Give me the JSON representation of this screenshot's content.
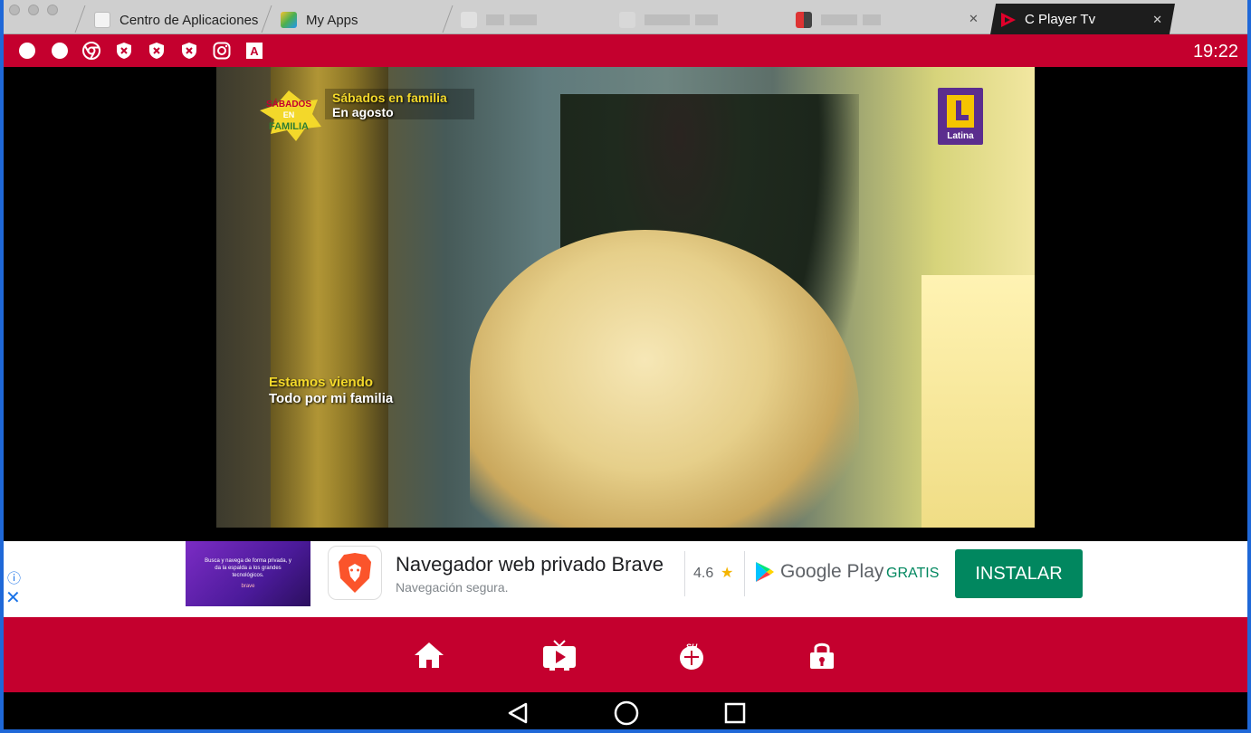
{
  "tabs": [
    {
      "label": "Centro de Aplicaciones",
      "icon": "app-center-icon"
    },
    {
      "label": "My Apps",
      "icon": "bluestacks-icon"
    },
    {
      "label": "",
      "icon": "blurred-tab-icon"
    },
    {
      "label": "",
      "icon": "blurred-tab-icon"
    },
    {
      "label": "",
      "icon": "blurred-tab-icon"
    },
    {
      "label": "C Player Tv",
      "icon": "c-player-icon",
      "active": true
    }
  ],
  "status_bar": {
    "time": "19:22",
    "icons": [
      "dot-icon",
      "dot-icon",
      "chrome-icon",
      "shield-x-icon",
      "shield-x-icon",
      "shield-x-icon",
      "instagram-icon",
      "a-icon"
    ]
  },
  "video": {
    "overlay_top_line1": "Sábados en familia",
    "overlay_top_line2": "En agosto",
    "logo_text_line1": "SÁBADOS",
    "logo_text_line2": "EN",
    "logo_text_line3": "FAMILIA",
    "overlay_bottom_line1": "Estamos viendo",
    "overlay_bottom_line2": "Todo por mi familia",
    "channel_name": "Latina"
  },
  "ad": {
    "thumb_text": "Busca y navega de forma privada, y da la espalda a los grandes tecnológicos.",
    "thumb_brand": "brave",
    "title": "Navegador web privado Brave",
    "subtitle": "Navegación segura.",
    "rating": "4.6",
    "star": "★",
    "store": "Google Play",
    "price": "GRATIS",
    "install": "INSTALAR",
    "info_icon": "ⓘ",
    "close_icon": "✕"
  },
  "colors": {
    "accent": "#c4002e",
    "install_green": "#01875f",
    "frame_blue": "#1f68d8"
  }
}
